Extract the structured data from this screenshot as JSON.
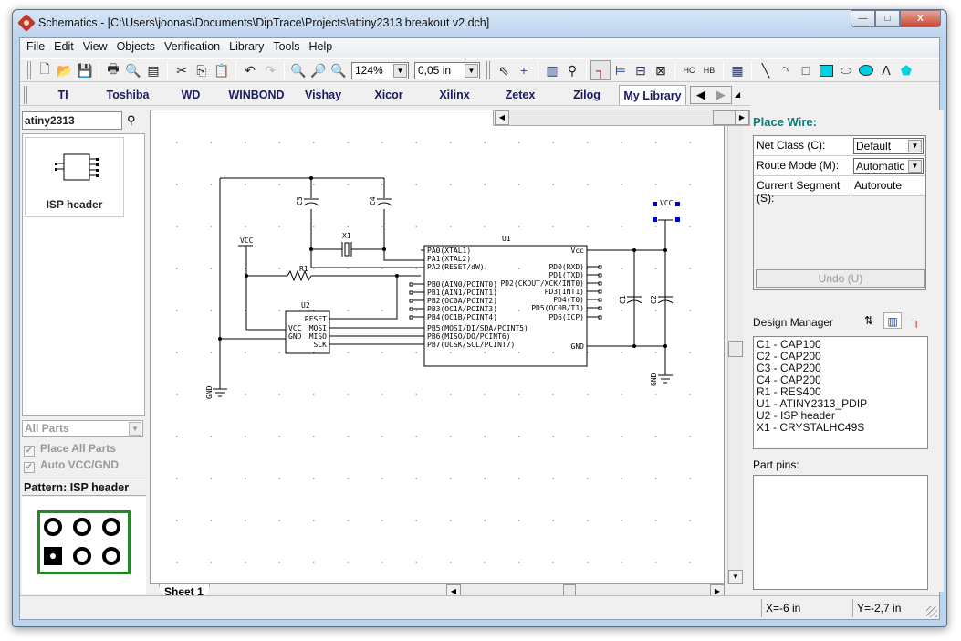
{
  "window": {
    "title": "Schematics - [C:\\Users\\joonas\\Documents\\DipTrace\\Projects\\attiny2313 breakout v2.dch]",
    "min": "—",
    "max": "□",
    "close": "X"
  },
  "menu": [
    "File",
    "Edit",
    "View",
    "Objects",
    "Verification",
    "Library",
    "Tools",
    "Help"
  ],
  "toolbar": {
    "zoom_value": "124%",
    "grid_value": "0,05 in",
    "icons": [
      "new-icon",
      "open-icon",
      "save-icon",
      "print-icon",
      "print-preview-icon",
      "report-icon",
      "cut-icon",
      "copy-icon",
      "paste-icon",
      "undo-icon",
      "redo-icon",
      "zoom-window-icon",
      "zoom-in-icon",
      "zoom-out-icon",
      "select-icon",
      "crosshair-icon",
      "place-part-icon",
      "find-icon",
      "place-wire-icon",
      "place-bus-icon",
      "net-port-icon",
      "bus-entry-icon",
      "hierarchy-in-icon",
      "hierarchy-block-icon",
      "table-icon",
      "line-icon",
      "arc-icon",
      "rectangle-icon",
      "filled-rectangle-icon",
      "ellipse-icon",
      "filled-ellipse-icon",
      "polyline-icon",
      "polygon-icon"
    ]
  },
  "library_tabs": [
    "TI",
    "Toshiba",
    "WD",
    "WINBOND",
    "Vishay",
    "Xicor",
    "Xilinx",
    "Zetex",
    "Zilog",
    "My Library"
  ],
  "library_tabs_active": "My Library",
  "left_panel": {
    "search_value": "atiny2313",
    "part_card": "ISP header",
    "filter": "All Parts",
    "place_all_parts": "Place All Parts",
    "auto_vcc_gnd": "Auto VCC/GND",
    "pattern_label": "Pattern: ISP header"
  },
  "schematic": {
    "u1_ref": "U1",
    "u1_left_pins": [
      "PA0(XTAL1)",
      "PA1(XTAL2)",
      "PA2(RESET/dW)",
      "PB0(AIN0/PCINT0)",
      "PB1(AIN1/PCINT1)",
      "PB2(OC0A/PCINT2)",
      "PB3(OC1A/PCINT3)",
      "PB4(OC1B/PCINT4)",
      "PB5(MOSI/DI/SDA/PCINT5)",
      "PB6(MISO/DO/PCINT6)",
      "PB7(UCSK/SCL/PCINT7)"
    ],
    "u1_right_pins": [
      "Vcc",
      "PD0(RXD)",
      "PD1(TXD)",
      "PD2(CKOUT/XCK/INT0)",
      "PD3(INT1)",
      "PD4(T0)",
      "PD5(OC0B/T1)",
      "PD6(ICP)",
      "GND"
    ],
    "u2_ref": "U2",
    "u2_left_pins": [
      "VCC",
      "GND"
    ],
    "u2_right_pins": [
      "RESET",
      "MOSI",
      "MISO",
      "SCK"
    ],
    "r1": "R1",
    "x1": "X1",
    "c1": "C1",
    "c2": "C2",
    "c3": "C3",
    "c4": "C4",
    "vcc": "VCC",
    "gnd": "GND"
  },
  "sheet_tab": "Sheet 1",
  "right_panel": {
    "place_wire_title": "Place Wire:",
    "props": [
      {
        "label": "Net Class (C):",
        "value": "Default",
        "type": "combo"
      },
      {
        "label": "Route Mode (M):",
        "value": "Automatic",
        "type": "combo"
      },
      {
        "label": "Current Segment (S):",
        "value": "Autoroute",
        "type": "text"
      }
    ],
    "undo_button": "Undo (U)",
    "design_manager_label": "Design Manager",
    "components": [
      "C1 - CAP100",
      "C2 - CAP200",
      "C3 - CAP200",
      "C4 - CAP200",
      "R1 - RES400",
      "U1 - ATINY2313_PDIP",
      "U2 - ISP header",
      "X1 - CRYSTALHC49S"
    ],
    "part_pins_label": "Part pins:"
  },
  "status": {
    "x": "X=-6 in",
    "y": "Y=-2,7 in"
  },
  "colors": {
    "accent_title": "#0f7a7a",
    "pcb_outline": "#228b22",
    "selection": "#0000cc",
    "lib_tab_text": "#1a1a66"
  }
}
